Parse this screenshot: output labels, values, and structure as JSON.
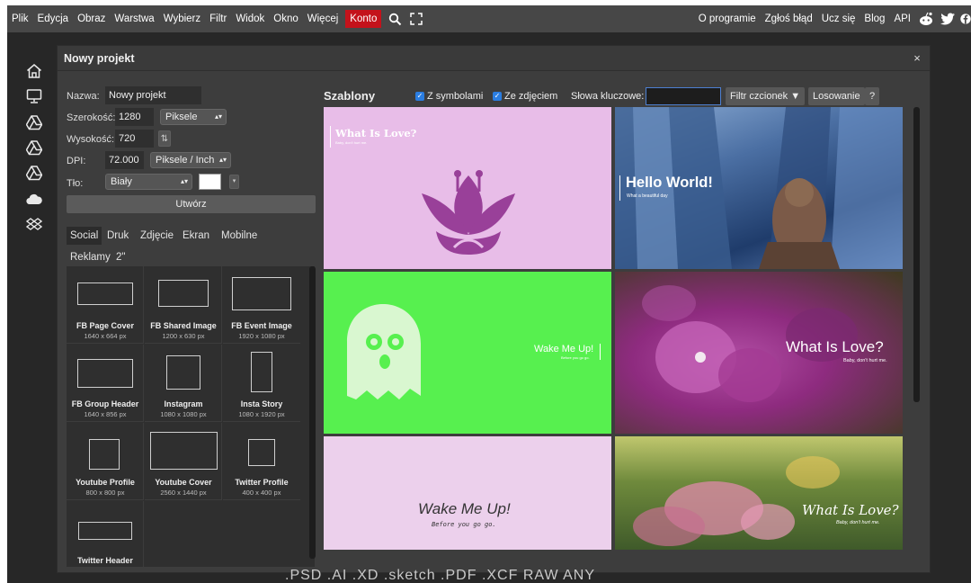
{
  "menubar": {
    "items": [
      "Plik",
      "Edycja",
      "Obraz",
      "Warstwa",
      "Wybierz",
      "Filtr",
      "Widok",
      "Okno",
      "Więcej"
    ],
    "account": "Konto",
    "right_items": [
      "O programie",
      "Zgłoś błąd",
      "Ucz się",
      "Blog",
      "API"
    ],
    "accent_color": "#c4121b"
  },
  "toolbar": {
    "icons": [
      "home-icon",
      "monitor-icon",
      "google-drive-icon",
      "google-drive-icon",
      "google-drive-icon",
      "onedrive-cloud-icon",
      "dropbox-icon"
    ]
  },
  "dialog": {
    "title": "Nowy projekt",
    "close": "×",
    "name_label": "Nazwa:",
    "name_value": "Nowy projekt",
    "width_label": "Szerokość:",
    "width_value": "1280",
    "width_unit": "Piksele",
    "height_label": "Wysokość:",
    "height_value": "720",
    "dpi_label": "DPI:",
    "dpi_value": "72.000",
    "dpi_unit": "Piksele / Inch",
    "bg_label": "Tło:",
    "bg_value": "Biały",
    "create_button": "Utwórz"
  },
  "categories": {
    "tabs": [
      "Social",
      "Druk",
      "Zdjęcie",
      "Ekran",
      "Mobilne",
      "Reklamy",
      "2\""
    ],
    "active": "Social"
  },
  "presets": [
    {
      "name": "FB Page Cover",
      "size": "1640 x 664 px"
    },
    {
      "name": "FB Shared Image",
      "size": "1200 x 630 px"
    },
    {
      "name": "FB Event Image",
      "size": "1920 x 1080 px"
    },
    {
      "name": "FB Group Header",
      "size": "1640 x 856 px"
    },
    {
      "name": "Instagram",
      "size": "1080 x 1080 px"
    },
    {
      "name": "Insta Story",
      "size": "1080 x 1920 px"
    },
    {
      "name": "Youtube Profile",
      "size": "800 x 800 px"
    },
    {
      "name": "Youtube Cover",
      "size": "2560 x 1440 px"
    },
    {
      "name": "Twitter Profile",
      "size": "400 x 400 px"
    },
    {
      "name": "Twitter Header",
      "size": ""
    }
  ],
  "templates_panel": {
    "title": "Szablony",
    "symbols_checkbox": "Z symbolami",
    "photo_checkbox": "Ze zdjęciem",
    "keywords_label": "Słowa kluczowe:",
    "keywords_value": "",
    "font_filter_button": "Filtr czcionek",
    "random_button": "Losowanie",
    "help_button": "?"
  },
  "templates": [
    {
      "title": "What Is Love?",
      "subtitle": "Baby, don't hurt me.",
      "bg": "#e8bde8"
    },
    {
      "title": "Hello World!",
      "subtitle": "What a beautiful day",
      "bg": "#5d7fb0"
    },
    {
      "title": "Wake Me Up!",
      "subtitle": "Before you go go.",
      "bg": "#57f04f"
    },
    {
      "title": "What Is Love?",
      "subtitle": "Baby, don't hurt me.",
      "bg": "#8e2b7f"
    },
    {
      "title": "Wake Me Up!",
      "subtitle": "Before you go go.",
      "bg": "#ecd0ec"
    },
    {
      "title": "What Is Love?",
      "subtitle": "Baby, don't hurt me.",
      "bg": "#6f8a3c"
    }
  ],
  "bottom_formats": ".PSD  .AI  .XD  .sketch  .PDF  .XCF  RAW  ANY"
}
